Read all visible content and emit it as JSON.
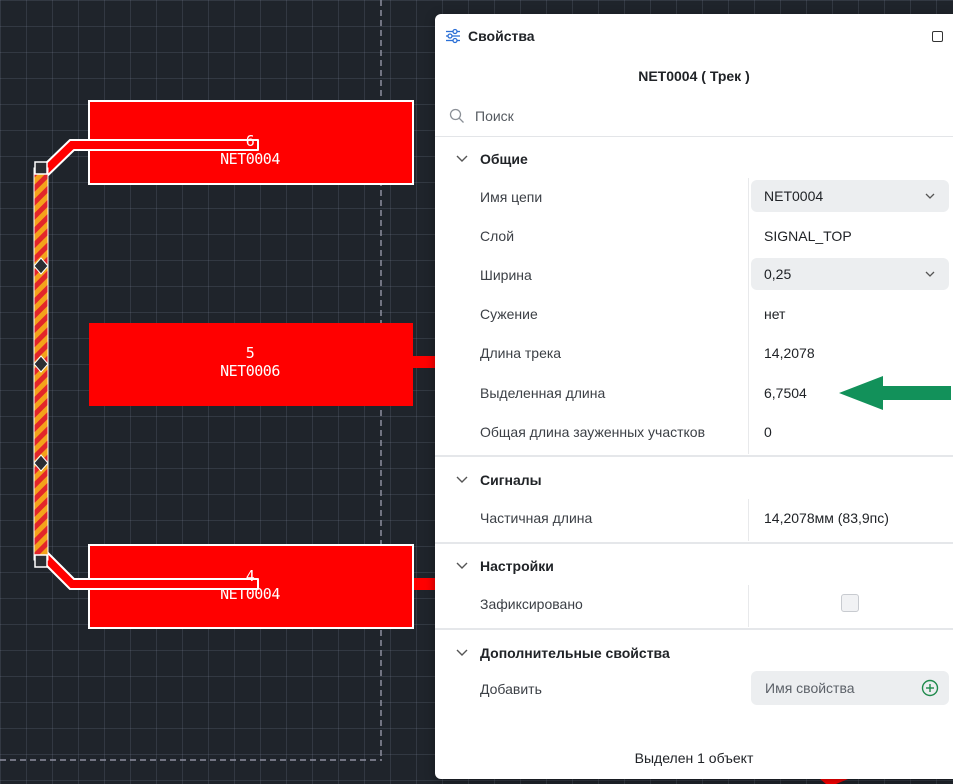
{
  "canvas": {
    "pads": [
      {
        "number": "6",
        "net": "NET0004"
      },
      {
        "number": "5",
        "net": "NET0006"
      },
      {
        "number": "4",
        "net": "NET0004"
      }
    ]
  },
  "panel": {
    "title": "Свойства",
    "subtitle": "NET0004 ( Трек )",
    "search_placeholder": "Поиск",
    "sections": {
      "general": {
        "title": "Общие",
        "rows": {
          "net_name": {
            "label": "Имя цепи",
            "value": "NET0004"
          },
          "layer": {
            "label": "Слой",
            "value": "SIGNAL_TOP"
          },
          "width": {
            "label": "Ширина",
            "value": "0,25"
          },
          "narrowing": {
            "label": "Сужение",
            "value": "нет"
          },
          "track_length": {
            "label": "Длина трека",
            "value": "14,2078"
          },
          "selected_length": {
            "label": "Выделенная длина",
            "value": "6,7504"
          },
          "narrowed_total": {
            "label": "Общая длина зауженных участков",
            "value": "0"
          }
        }
      },
      "signals": {
        "title": "Сигналы",
        "rows": {
          "partial_length": {
            "label": "Частичная длина",
            "value": "14,2078мм (83,9пс)"
          }
        }
      },
      "settings": {
        "title": "Настройки",
        "rows": {
          "fixed": {
            "label": "Зафиксировано",
            "checked": false
          }
        }
      },
      "extra": {
        "title": "Дополнительные свойства",
        "rows": {
          "add": {
            "label": "Добавить",
            "placeholder": "Имя свойства"
          }
        }
      }
    },
    "footer": "Выделен 1 объект"
  },
  "colors": {
    "pad": "#ff0000",
    "canvas_bg": "#1f242b",
    "track_stripe_a": "#f4a31a",
    "track_stripe_b": "#e3262a",
    "annotation_arrow": "#12915a"
  },
  "icons": {
    "panel_icon": "sliders-icon",
    "window_button": "maximize-icon",
    "search": "search-icon",
    "section_toggle": "chevron-down-icon",
    "select_toggle": "chevron-down-icon",
    "add": "plus-circle-icon"
  }
}
